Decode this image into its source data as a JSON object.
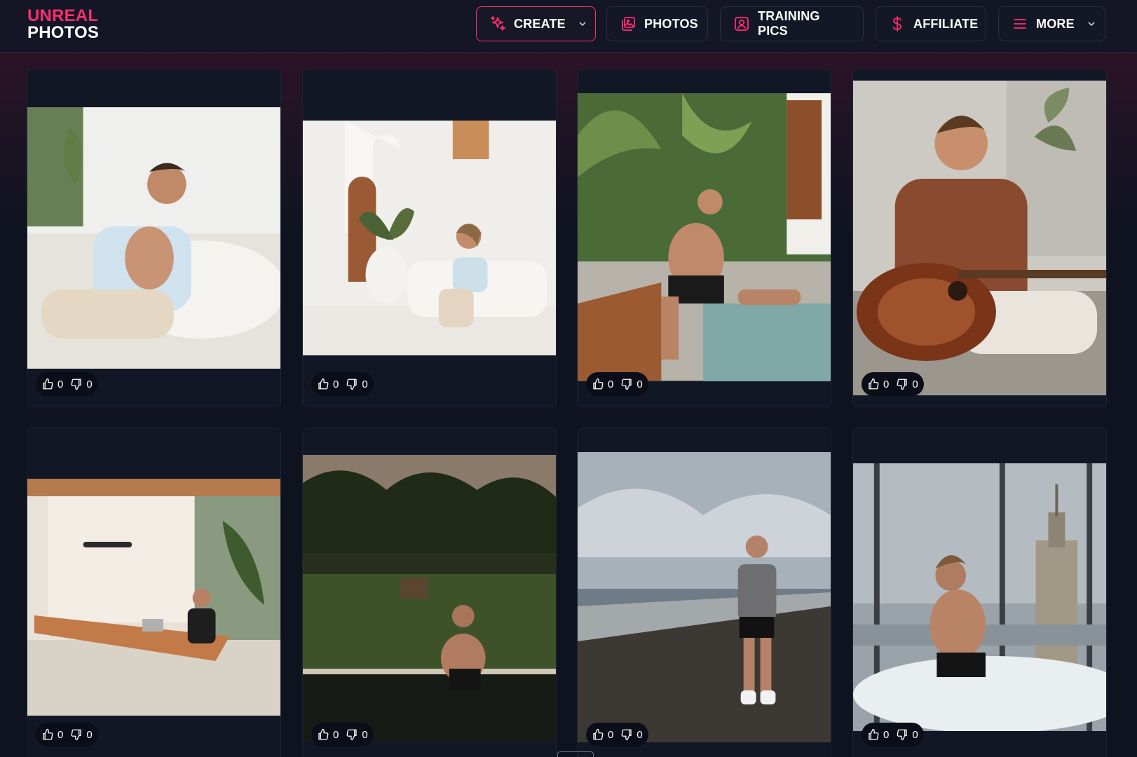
{
  "brand": {
    "line1": "UNREAL",
    "line2": "PHOTOS",
    "accent": "#ff2d6f"
  },
  "nav": [
    {
      "label": "CREATE",
      "icon": "sparkles-icon",
      "dropdown": true,
      "active": true
    },
    {
      "label": "PHOTOS",
      "icon": "images-icon",
      "dropdown": false,
      "active": false
    },
    {
      "label": "TRAINING PICS",
      "icon": "user-portrait-icon",
      "dropdown": false,
      "active": false
    },
    {
      "label": "AFFILIATE",
      "icon": "dollar-icon",
      "dropdown": false,
      "active": false
    },
    {
      "label": "MORE",
      "icon": "menu-icon",
      "dropdown": true,
      "active": false
    }
  ],
  "photos": [
    {
      "scene": "man-on-white-sofa",
      "likes": "0",
      "dislikes": "0"
    },
    {
      "scene": "man-on-sofa-arched-door",
      "likes": "0",
      "dislikes": "0"
    },
    {
      "scene": "man-by-tropical-pool",
      "likes": "0",
      "dislikes": "0"
    },
    {
      "scene": "man-playing-guitar",
      "likes": "0",
      "dislikes": "0"
    },
    {
      "scene": "man-at-dining-table-laptop",
      "likes": "0",
      "dislikes": "0"
    },
    {
      "scene": "man-in-jungle-pool",
      "likes": "0",
      "dislikes": "0"
    },
    {
      "scene": "man-on-beach",
      "likes": "0",
      "dislikes": "0"
    },
    {
      "scene": "man-in-rooftop-jacuzzi",
      "likes": "0",
      "dislikes": "0"
    }
  ]
}
